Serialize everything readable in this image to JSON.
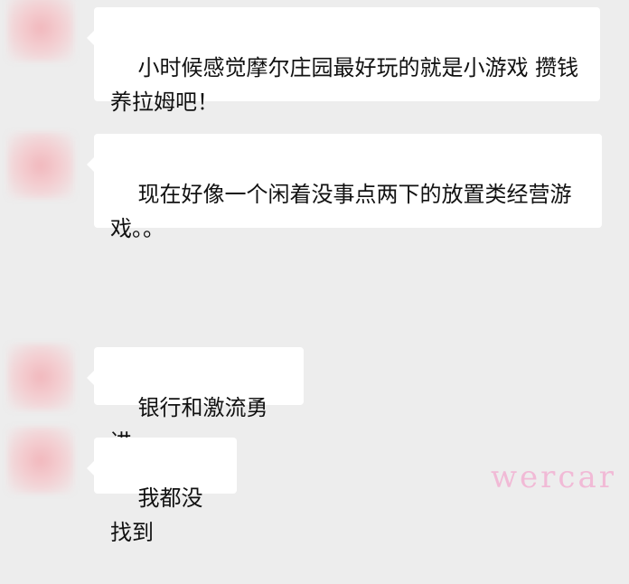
{
  "messages": [
    {
      "text": "小时候感觉摩尔庄园最好玩的就是小游戏 攒钱养拉姆吧！"
    },
    {
      "text": "现在好像一个闲着没事点两下的放置类经营游戏。。"
    },
    {
      "text": "银行和激流勇进"
    },
    {
      "text": "我都没找到"
    }
  ],
  "watermark": "wercar"
}
